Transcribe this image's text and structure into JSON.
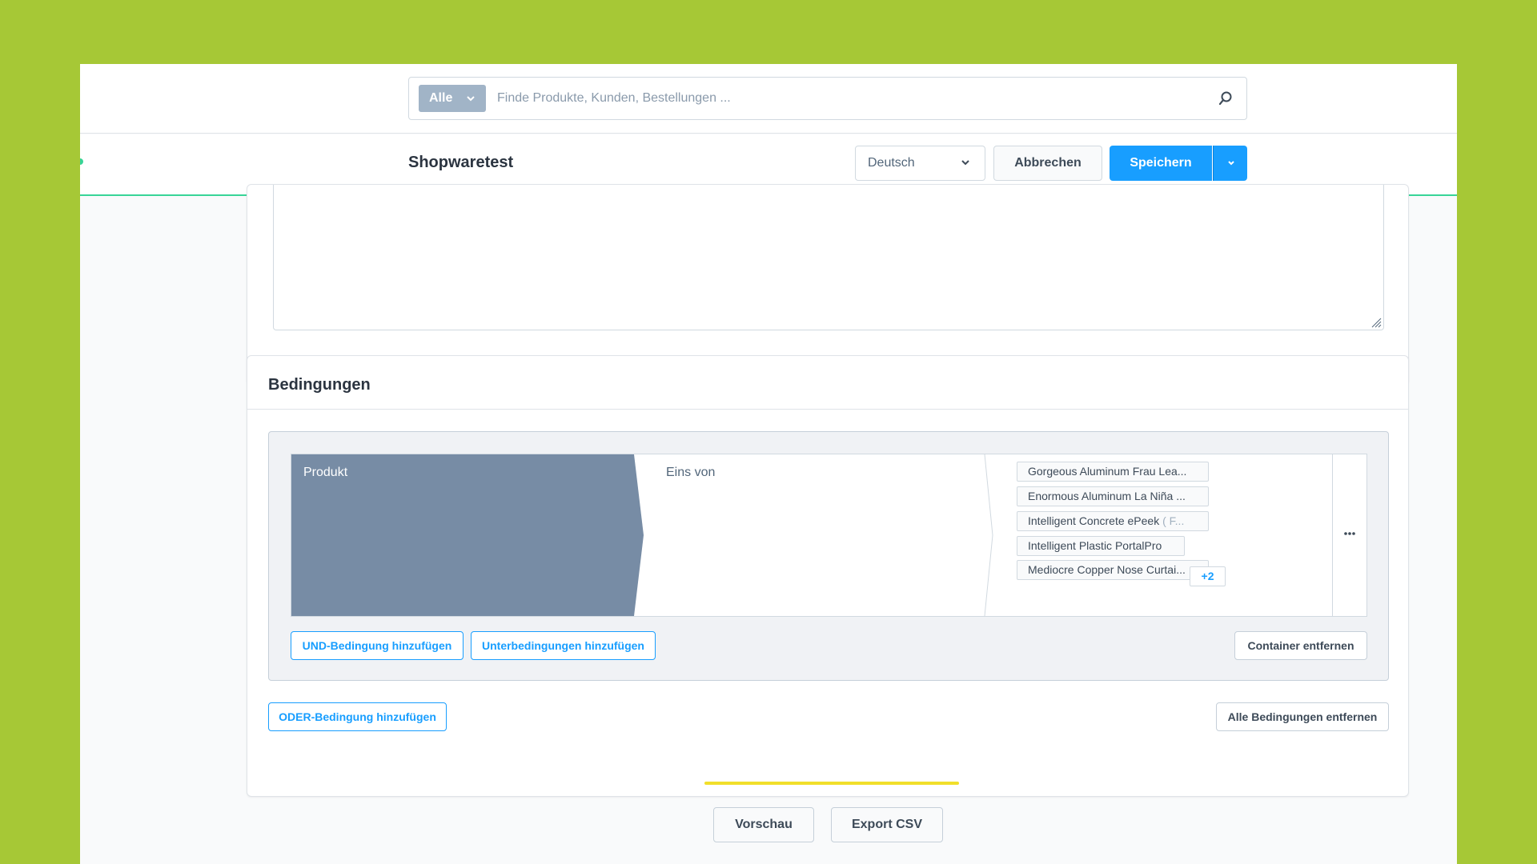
{
  "search": {
    "type_label": "Alle",
    "placeholder": "Finde Produkte, Kunden, Bestellungen ..."
  },
  "smartbar": {
    "title": "Shopwaretest",
    "language": "Deutsch",
    "cancel_label": "Abbrechen",
    "save_label": "Speichern"
  },
  "conditions": {
    "title": "Bedingungen",
    "field": "Produkt",
    "operator": "Eins von",
    "values": [
      {
        "text": "Gorgeous Aluminum Frau Lea..."
      },
      {
        "text": "Enormous Aluminum La Niña ..."
      },
      {
        "text": "Intelligent Concrete ePeek",
        "muted": "( F..."
      },
      {
        "text": "Intelligent Plastic PortalPro"
      },
      {
        "text": "Mediocre Copper Nose Curtai..."
      }
    ],
    "more_count": "+2",
    "add_and_label": "UND-Bedingung hinzufügen",
    "add_sub_label": "Unterbedingungen hinzufügen",
    "remove_container_label": "Container entfernen",
    "add_or_label": "ODER-Bedingung hinzufügen",
    "remove_all_label": "Alle Bedingungen entfernen"
  },
  "actions": {
    "preview_label": "Vorschau",
    "export_label": "Export CSV"
  },
  "colors": {
    "background": "#a6c836",
    "primary": "#189eff",
    "field_bg": "#778ca5",
    "accent_line": "#37d497",
    "highlight": "#f1df2a"
  }
}
